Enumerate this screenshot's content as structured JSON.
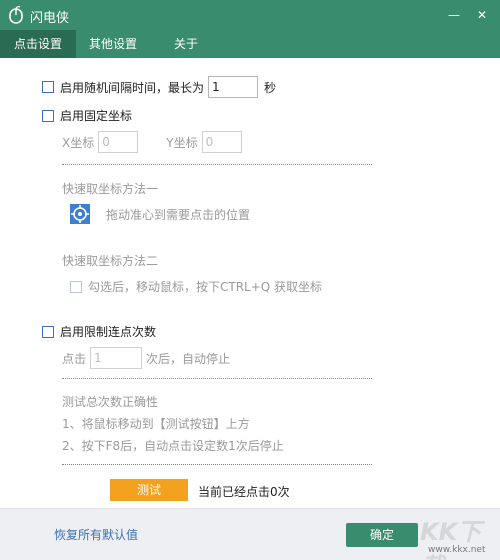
{
  "window": {
    "title": "闪电侠",
    "min_glyph": "—",
    "close_glyph": "✕"
  },
  "tabs": [
    "点击设置",
    "其他设置",
    "关于"
  ],
  "random_interval": {
    "label": "启用随机间隔时间，最长为",
    "value": "1",
    "unit": "秒"
  },
  "fixed_coords": {
    "label": "启用固定坐标",
    "x_label": "X坐标",
    "x_value": "0",
    "y_label": "Y坐标",
    "y_value": "0",
    "method1_title": "快速取坐标方法一",
    "method1_desc": "拖动准心到需要点击的位置",
    "method2_title": "快速取坐标方法二",
    "method2_check": "勾选后，移动鼠标，按下CTRL+Q 获取坐标"
  },
  "limit_clicks": {
    "label": "启用限制连点次数",
    "prefix": "点击",
    "value": "1",
    "suffix": "次后，自动停止"
  },
  "test": {
    "title": "测试总次数正确性",
    "step1": "1、将鼠标移动到【测试按钮】上方",
    "step2": "2、按下F8后，自动点击设定数1次后停止",
    "button": "测试",
    "status": "当前已经点击0次"
  },
  "footer": {
    "reset": "恢复所有默认值",
    "ok": "确定"
  },
  "watermark": {
    "big": "KK下载",
    "small": "www.kkx.net"
  },
  "colors": {
    "theme": "#3a8c6e",
    "active_tab": "#2a6b53",
    "test_button": "#f4a11f",
    "link": "#3b6fb5"
  }
}
